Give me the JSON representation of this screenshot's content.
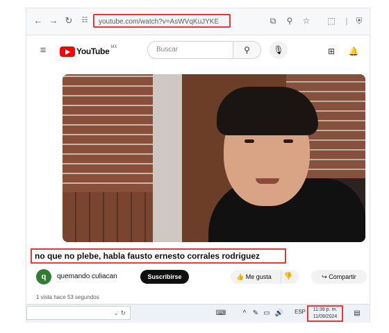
{
  "browser": {
    "url": "youtube.com/watch?v=AsWVqKuJYKE",
    "icons": [
      "back-arrow-icon",
      "forward-arrow-icon",
      "reload-icon",
      "site-info-icon",
      "cast-icon",
      "zoom-icon",
      "star-icon",
      "extensions-icon",
      "profile-icon"
    ]
  },
  "youtube": {
    "logo_text": "YouTube",
    "logo_cc": "MX",
    "search_placeholder": "Buscar"
  },
  "video": {
    "title": "no que no plebe, habla fausto ernesto corrales rodriguez",
    "channel": "quemando culiacan",
    "avatar_letter": "q",
    "subscribe_label": "Suscribirse",
    "like_label": "Me gusta",
    "share_label": "Compartir",
    "description_preview": "1 vista  hace 53 segundos"
  },
  "taskbar": {
    "lang": "ESP",
    "time": "11:39 p. m.",
    "date": "11/09/2024"
  },
  "colors": {
    "highlight": "#e53935",
    "youtube_red": "#ff0000"
  }
}
